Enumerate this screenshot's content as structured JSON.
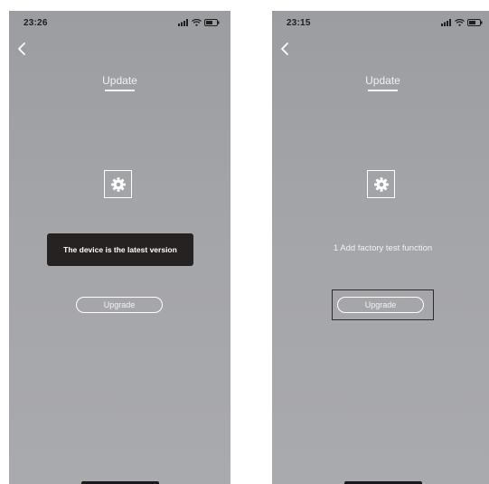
{
  "screens": [
    {
      "id": "left",
      "status_time": "23:26",
      "title": "Update",
      "toast": "The device is the latest version",
      "release_note": "",
      "upgrade_label": "Upgrade",
      "highlighted": false
    },
    {
      "id": "right",
      "status_time": "23:15",
      "title": "Update",
      "toast": "",
      "release_note": "1 Add factory test function",
      "upgrade_label": "Upgrade",
      "highlighted": true
    }
  ],
  "icons": {
    "back": "chevron-left-icon",
    "device": "gear-icon",
    "signal": "cellular-signal-icon",
    "wifi": "wifi-icon",
    "battery": "battery-icon"
  },
  "colors": {
    "screen_background": "#a2a3a7",
    "foreground": "#ffffff",
    "toast_background": "#262222",
    "status_text": "#1e1e1e",
    "highlight_frame": "#2c2c2c"
  }
}
